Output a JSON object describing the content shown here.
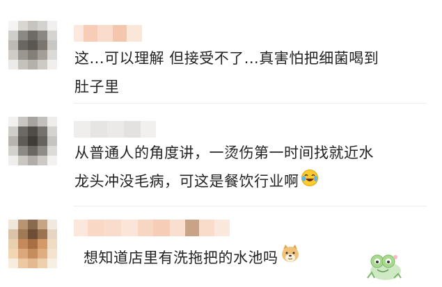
{
  "comments": [
    {
      "text_line1": "这...可以理解 但接受不了...真害怕把细菌喝到",
      "text_line2": "肚子里"
    },
    {
      "text_line1": "从普通人的角度讲，一烫伤第一时间找就近水",
      "text_line2": "龙头冲没毛病，可这是餐饮行业啊",
      "emoji": "laughing-tears-icon"
    },
    {
      "text_line1": "想知道店里有洗拖把的水池吗",
      "emoji": "doge-icon",
      "sticker": "frog-sticker-icon"
    }
  ]
}
